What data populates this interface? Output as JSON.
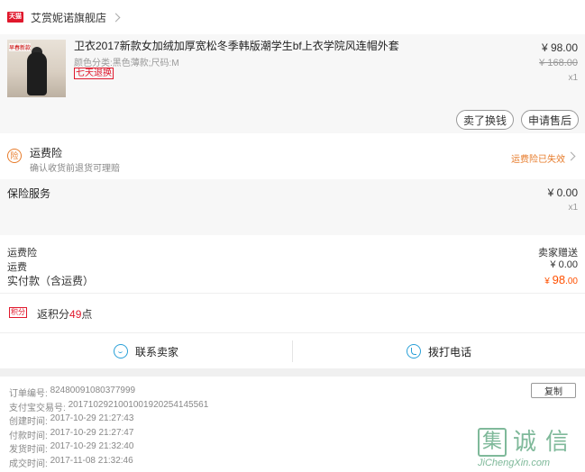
{
  "shop": {
    "logo_text": "天猫",
    "name": "艾赏妮诺旗舰店"
  },
  "item": {
    "thumb_tag": "早春新款",
    "title": "卫衣2017新款女加绒加厚宽松冬季韩版潮学生bf上衣学院风连帽外套",
    "attrs": "颜色分类:黑色薄款;尺码:M",
    "return_badge": "七天退换",
    "price": "¥ 98.00",
    "original_price": "¥ 168.00",
    "qty": "x1",
    "btn_resell": "卖了换钱",
    "btn_aftersale": "申请售后"
  },
  "insurance": {
    "icon_text": "险",
    "title": "运费险",
    "subtitle": "确认收货前退货可理赔",
    "status": "运费险已失效"
  },
  "service": {
    "title": "保险服务",
    "price": "¥ 0.00",
    "qty": "x1"
  },
  "summary": {
    "rows": [
      {
        "label": "运费险",
        "value": "卖家赠送"
      },
      {
        "label": "运费",
        "value": "¥ 0.00"
      }
    ],
    "total_label": "实付款（含运费）",
    "total_currency": "¥ ",
    "total_int": "98",
    "total_dec": ".00"
  },
  "points": {
    "icon_text": "积分",
    "prefix": "返积分",
    "value": "49",
    "suffix": "点"
  },
  "contact": {
    "seller": "联系卖家",
    "phone": "拨打电话"
  },
  "order_info": {
    "copy_label": "复制",
    "rows": [
      {
        "k": "订单编号:",
        "v": "82480091080377999"
      },
      {
        "k": "支付宝交易号:",
        "v": "2017102921001001920254145561"
      },
      {
        "k": "创建时间:",
        "v": "2017-10-29 21:27:43"
      },
      {
        "k": "付款时间:",
        "v": "2017-10-29 21:27:47"
      },
      {
        "k": "发货时间:",
        "v": "2017-10-29 21:32:40"
      },
      {
        "k": "成交时间:",
        "v": "2017-11-08 21:32:46"
      }
    ]
  },
  "watermark": {
    "c1": "集",
    "c2": "诚",
    "c3": "信",
    "url": "JiChengXin.com"
  },
  "colors": {
    "accent": "#ff5000",
    "brand": "#e0182c",
    "link_icon": "#2aa0d8"
  }
}
